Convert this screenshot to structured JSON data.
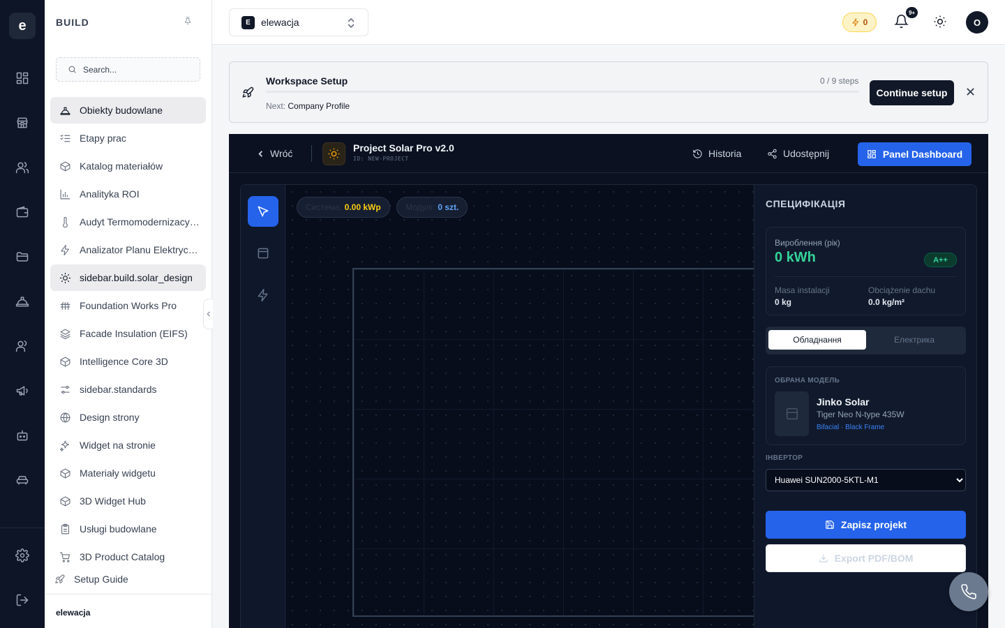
{
  "rail": {
    "logo": "e",
    "icons": [
      "dashboard-icon",
      "store-icon",
      "users-icon",
      "wallet-icon",
      "folder-icon",
      "construction-icon",
      "team-icon",
      "megaphone-icon",
      "bot-icon",
      "car-icon",
      "settings-icon",
      "logout-icon"
    ]
  },
  "sidebar": {
    "title": "BUILD",
    "search_placeholder": "Search...",
    "items": [
      {
        "label": "Obiekty budowlane",
        "icon": "hard-hat-icon",
        "active": true
      },
      {
        "label": "Etapy prac",
        "icon": "checklist-icon",
        "active": false
      },
      {
        "label": "Katalog materiałów",
        "icon": "box-icon",
        "active": false
      },
      {
        "label": "Analityka ROI",
        "icon": "bar-chart-icon",
        "active": false
      },
      {
        "label": "Audyt Termomodernizacyjny",
        "icon": "thermometer-icon",
        "active": false
      },
      {
        "label": "Analizator Planu Elektrycznego",
        "icon": "lightning-icon",
        "active": false
      },
      {
        "label": "sidebar.build.solar_design",
        "icon": "sun-icon",
        "active": true
      },
      {
        "label": "Foundation Works Pro",
        "icon": "foundation-icon",
        "active": false
      },
      {
        "label": "Facade Insulation (EIFS)",
        "icon": "layers-icon",
        "active": false
      },
      {
        "label": "Intelligence Core 3D",
        "icon": "cube-icon",
        "active": false
      },
      {
        "label": "sidebar.standards",
        "icon": "sliders-icon",
        "active": false
      },
      {
        "label": "Design strony",
        "icon": "globe-icon",
        "active": false
      },
      {
        "label": "Widget na stronie",
        "icon": "sparkle-icon",
        "active": false
      },
      {
        "label": "Materiały widgetu",
        "icon": "box-icon",
        "active": false
      },
      {
        "label": "3D Widget Hub",
        "icon": "cube-icon",
        "active": false
      },
      {
        "label": "Usługi budowlane",
        "icon": "clipboard-icon",
        "active": false
      },
      {
        "label": "3D Product Catalog",
        "icon": "cart-icon",
        "active": false
      }
    ],
    "setup_guide": "Setup Guide",
    "footer_workspace": "elewacja"
  },
  "topbar": {
    "workspace_badge": "E",
    "workspace_name": "elewacja",
    "energy_count": "0",
    "notifications_badge": "9+",
    "avatar_initial": "O"
  },
  "setup": {
    "title": "Workspace Setup",
    "steps": "0 / 9 steps",
    "progress": 0,
    "next_label": "Next:",
    "next_value": "Company Profile",
    "cta": "Continue setup"
  },
  "app": {
    "back_label": "Wróć",
    "project_name": "Project Solar Pro v2.0",
    "project_id": "ID: NEW-PROJECT",
    "history_label": "Historia",
    "share_label": "Udostępnij",
    "dashboard_label": "Panel Dashboard",
    "chips": [
      {
        "label": "Система:",
        "value": "0.00 kWp",
        "color": "#facc15"
      },
      {
        "label": "Модулі:",
        "value": "0 szt.",
        "color": "#60a5fa"
      }
    ],
    "spec": {
      "title": "СПЕЦИФІКАЦІЯ",
      "production_label": "Вироблення (рік)",
      "production_value": "0 kWh",
      "grade": "A++",
      "mass_label": "Masa instalacji",
      "mass_value": "0 kg",
      "load_label": "Obciążenie dachu",
      "load_value": "0.0 kg/m²",
      "tab_equipment": "Обладнання",
      "tab_electrical": "Електрика",
      "model_section": "ОБРАНА МОДЕЛЬ",
      "model_brand": "Jinko Solar",
      "model_name": "Tiger Neo N-type 435W",
      "model_tags": "Bifacial · Black Frame",
      "inverter_label": "ІНВЕРТОР",
      "inverter_value": "Huawei SUN2000-5KTL-M1",
      "save_label": "Zapisz projekt",
      "export_label": "Export PDF/BOM"
    }
  }
}
